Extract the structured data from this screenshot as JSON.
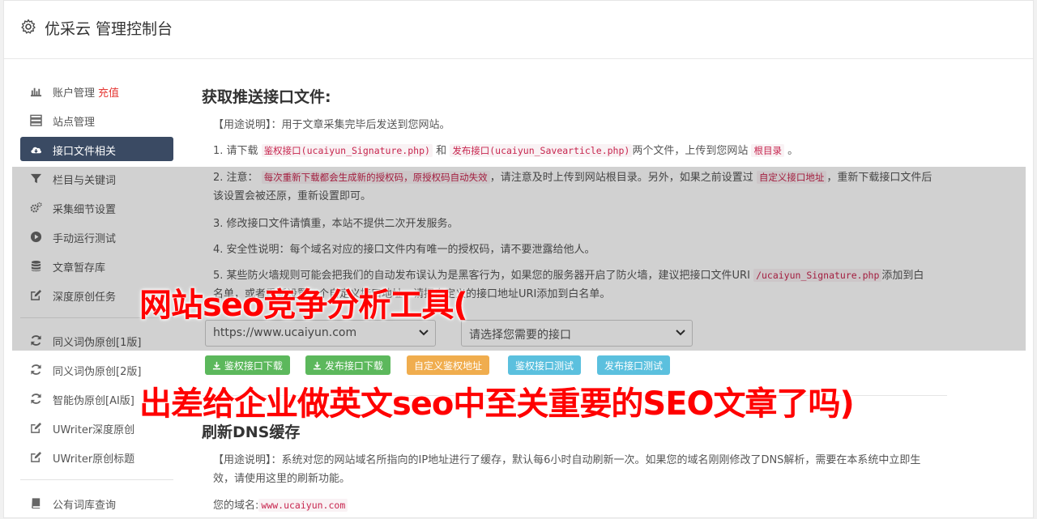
{
  "header": {
    "title": "优采云 管理控制台"
  },
  "sidebar": {
    "items": [
      {
        "label": "账户管理",
        "extra": "充值",
        "icon": "bar-chart-icon"
      },
      {
        "label": "站点管理",
        "icon": "server-icon"
      },
      {
        "label": "接口文件相关",
        "icon": "cloud-download-icon",
        "active": true
      },
      {
        "label": "栏目与关键词",
        "icon": "filter-icon"
      },
      {
        "label": "采集细节设置",
        "icon": "cogs-icon"
      },
      {
        "label": "手动运行测试",
        "icon": "play-circle-icon"
      },
      {
        "label": "文章暂存库",
        "icon": "database-icon"
      },
      {
        "label": "深度原创任务",
        "icon": "edit-icon"
      },
      {
        "label": "同义词伪原创[1版]",
        "icon": "refresh-icon"
      },
      {
        "label": "同义词伪原创[2版]",
        "icon": "refresh-icon"
      },
      {
        "label": "智能伪原创[AI版]",
        "icon": "refresh-icon"
      },
      {
        "label": "UWriter深度原创",
        "icon": "edit-icon"
      },
      {
        "label": "UWriter原创标题",
        "icon": "edit-icon"
      },
      {
        "label": "公有词库查询",
        "icon": "book-icon"
      }
    ]
  },
  "section1": {
    "title": "获取推送接口文件:",
    "usage": "【用途说明】：用于文章采集完毕后发送到您网站。",
    "line1": {
      "a": "1. 请下载",
      "code1": "鉴权接口(ucaiyun_Signature.php)",
      "b": "和",
      "code2": "发布接口(ucaiyun_Savearticle.php)",
      "c": "两个文件，上传到您网站",
      "code3": "根目录",
      "d": "。"
    },
    "line2": {
      "a": "2. 注意：",
      "code1": "每次重新下载都会生成新的授权码，原授权码自动失效",
      "b": "，请注意及时上传到网站根目录。另外，如果之前设置过",
      "code2": "自定义接口地址",
      "c": "，重新下载接口文件后该设置会被还原，重新设置即可。"
    },
    "line3": "3. 修改接口文件请慎重，本站不提供二次开发服务。",
    "line4": "4. 安全性说明：每个域名对应的接口文件内有唯一的授权码，请不要泄露给他人。",
    "line5": {
      "a": "5. 某些防火墙规则可能会把我们的自动发布误认为是黑客行为，如果您的服务器开启了防火墙，建议把接口文件URI",
      "code1": "/ucaiyun_Signature.php",
      "b": "添加到白名单，或者重新设置一个自定义接口地址，请把自定义的接口地址URI添加到白名单。"
    },
    "site_select": "https://www.ucaiyun.com",
    "api_select": "请选择您需要的接口",
    "buttons": {
      "download_sign": "鉴权接口下载",
      "download_publish": "发布接口下载",
      "custom_sign": "自定义鉴权地址",
      "test_sign": "鉴权接口测试",
      "test_publish": "发布接口测试"
    }
  },
  "section2": {
    "title": "刷新DNS缓存",
    "usage": "【用途说明】：系统对您的网站域名所指向的IP地址进行了缓存，默认每6小时自动刷新一次。如果您的域名刚刚修改了DNS解析，需要在本系统中立即生效，请使用这里的刷新功能。",
    "domain_label": "您的域名:",
    "domain_value": "www.ucaiyun.com"
  },
  "overlay_text": {
    "line1": "网站seo竞争分析工具(",
    "line2": "出差给企业做英文seo中至关重要的SEO文章了吗)"
  },
  "colors": {
    "active_bg": "#3a4a63",
    "green": "#5cb85c",
    "orange": "#f0ad4e",
    "blue": "#5bc0de",
    "overlay_red": "#ff0000"
  }
}
